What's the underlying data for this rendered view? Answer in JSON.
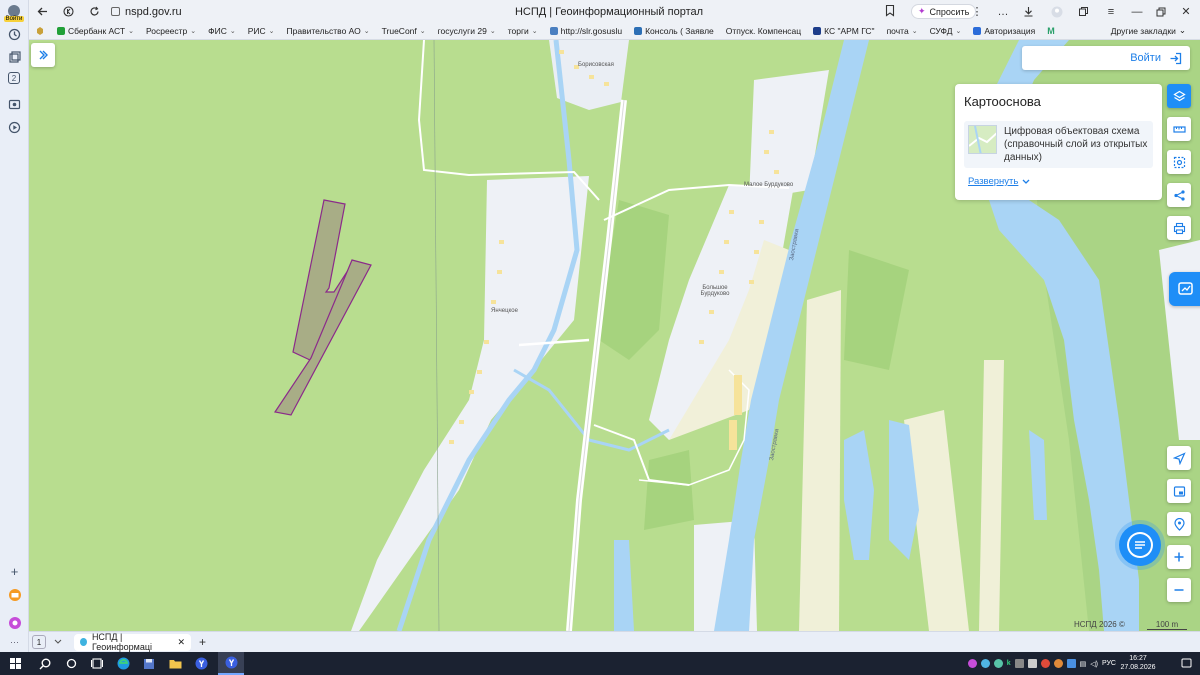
{
  "browser": {
    "url": "nspd.gov.ru",
    "page_title": "НСПД | Геоинформационный портал",
    "ask_label": "Спросить",
    "profile_tag": "Войти",
    "left_badge": "2"
  },
  "bookmarks": {
    "items": [
      {
        "label": "Сбербанк АСТ",
        "color": "#21a038",
        "dropdown": true
      },
      {
        "label": "Росреестр",
        "color": "",
        "dropdown": true
      },
      {
        "label": "ФИС",
        "color": "",
        "dropdown": true
      },
      {
        "label": "РИС",
        "color": "",
        "dropdown": true
      },
      {
        "label": "Правительство АО",
        "color": "",
        "dropdown": true
      },
      {
        "label": "TrueConf",
        "color": "",
        "dropdown": true
      },
      {
        "label": "госуслуги 29",
        "color": "",
        "dropdown": true
      },
      {
        "label": "торги",
        "color": "",
        "dropdown": true
      },
      {
        "label": "http://slr.gosuslu",
        "color": "#4a7fc0",
        "dropdown": false
      },
      {
        "label": "Консоль ( Заявле",
        "color": "#2d6fb5",
        "dropdown": false
      },
      {
        "label": "Отпуск. Компенсац",
        "color": "",
        "dropdown": false
      },
      {
        "label": "КС \"АРМ ГС\"",
        "color": "#1d3d8a",
        "dropdown": false
      },
      {
        "label": "почта",
        "color": "",
        "dropdown": true
      },
      {
        "label": "СУФД",
        "color": "",
        "dropdown": true
      },
      {
        "label": "Авторизация",
        "color": "#2b6cd9",
        "dropdown": false
      }
    ],
    "other": "Другие закладки"
  },
  "map": {
    "login_label": "Войти",
    "panel": {
      "title": "Картооснова",
      "layer_name": "Цифровая объектовая схема (справочный слой из открытых данных)",
      "expand_label": "Развернуть"
    },
    "labels": {
      "village1": "Борисовская",
      "village2": "Янчецкое",
      "village3": "Малое Бурдуково",
      "village4": "Большое Бурдуково",
      "river1": "Заостравка",
      "river2": "Заостравка"
    },
    "attribution": "НСПД 2026 ©",
    "scale": "100 m",
    "parcel_color": "#8b2a8a",
    "water_color": "#a9d4f5",
    "land_color": "#b8dd8f"
  },
  "tabs": {
    "count": "1",
    "active_tab": "НСПД | Геоинформаці"
  },
  "taskbar": {
    "time": "16:27",
    "date": "27.08.2026",
    "lang": "РУС"
  }
}
